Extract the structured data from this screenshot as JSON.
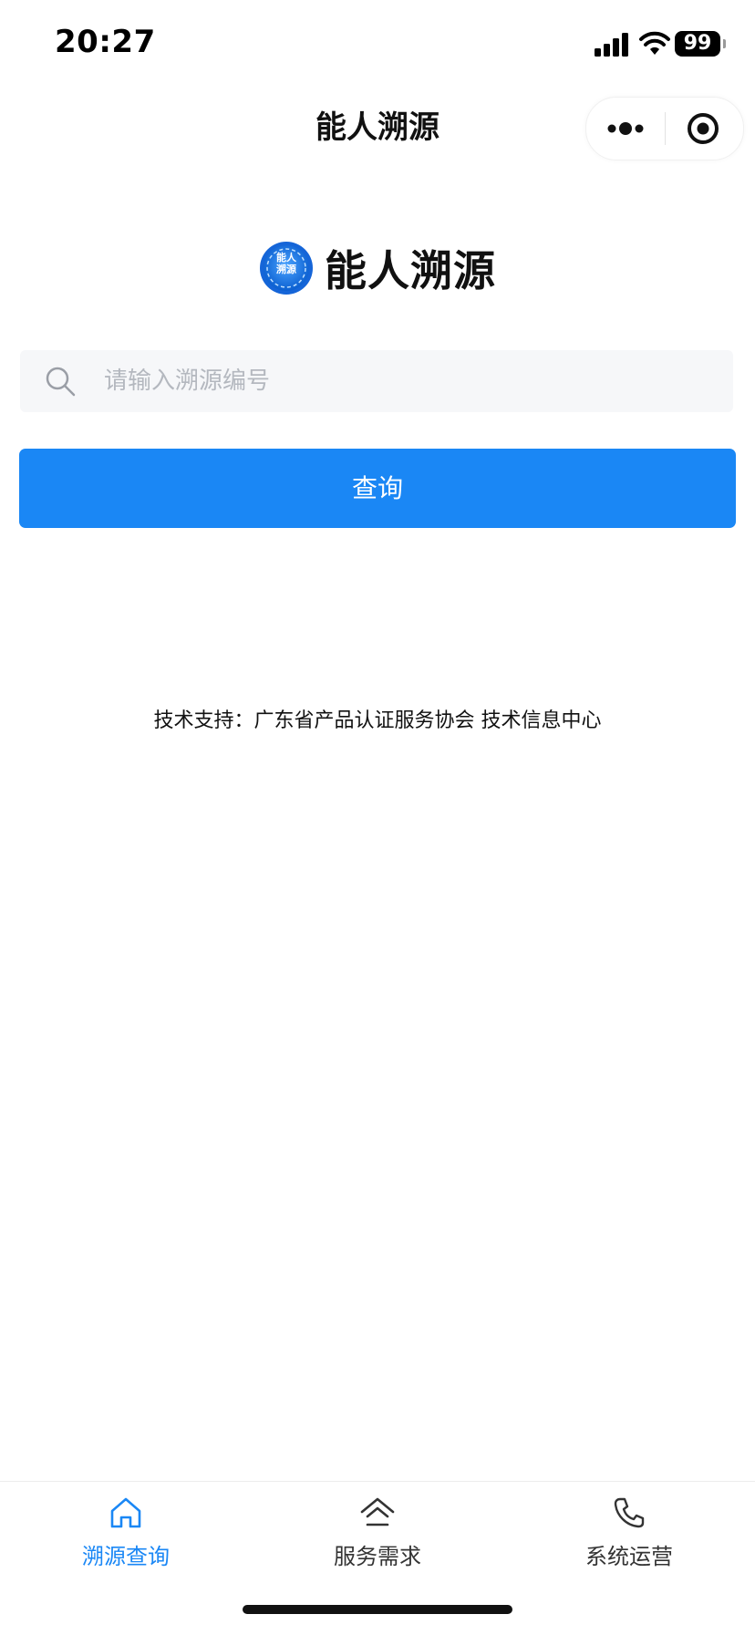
{
  "status_bar": {
    "time": "20:27",
    "battery": "99",
    "icons": [
      "signal-icon",
      "wifi-icon",
      "battery-icon"
    ]
  },
  "nav": {
    "title": "能人溯源",
    "capsule_icons": [
      "more-icon",
      "close-miniprogram-icon"
    ]
  },
  "brand": {
    "logo_text_line1": "能人",
    "logo_text_line2": "溯源",
    "name": "能人溯源"
  },
  "search": {
    "placeholder": "请输入溯源编号",
    "value": ""
  },
  "query_button": {
    "label": "查询"
  },
  "footer": {
    "support_text": "技术支持：广东省产品认证服务协会 技术信息中心"
  },
  "tabs": [
    {
      "label": "溯源查询",
      "icon": "home-icon",
      "active": true
    },
    {
      "label": "服务需求",
      "icon": "house-outline-icon",
      "active": false
    },
    {
      "label": "系统运营",
      "icon": "phone-icon",
      "active": false
    }
  ],
  "colors": {
    "accent": "#1a87f5",
    "search_bg": "#f6f7f9",
    "placeholder": "#b4b8bf",
    "text": "#111111"
  }
}
